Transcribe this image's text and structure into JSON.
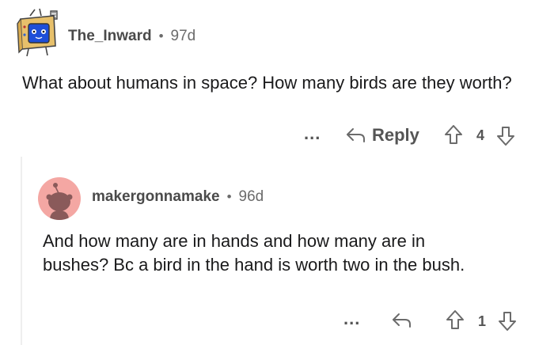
{
  "comments": [
    {
      "author": "The_Inward",
      "age": "97d",
      "body": "What about humans in space? How many birds are they worth?",
      "actions": {
        "more": "...",
        "reply_label": "Reply",
        "score": "4"
      }
    },
    {
      "author": "makergonnamake",
      "age": "96d",
      "body": "And how many are in hands and how many are in bushes? Bc a bird in the hand is worth two in the bush.",
      "actions": {
        "more": "...",
        "score": "1"
      }
    }
  ],
  "colors": {
    "avatar2_bg": "#f4a7a3",
    "avatar2_fg": "#8a5a5a",
    "icon": "#6b6b6b",
    "thread_line": "#eeeeee"
  },
  "icons": {
    "avatar1": "tv-robot-avatar-icon",
    "avatar2": "snoo-avatar-icon",
    "reply": "reply-arrow-icon",
    "upvote": "upvote-arrow-icon",
    "downvote": "downvote-arrow-icon"
  }
}
